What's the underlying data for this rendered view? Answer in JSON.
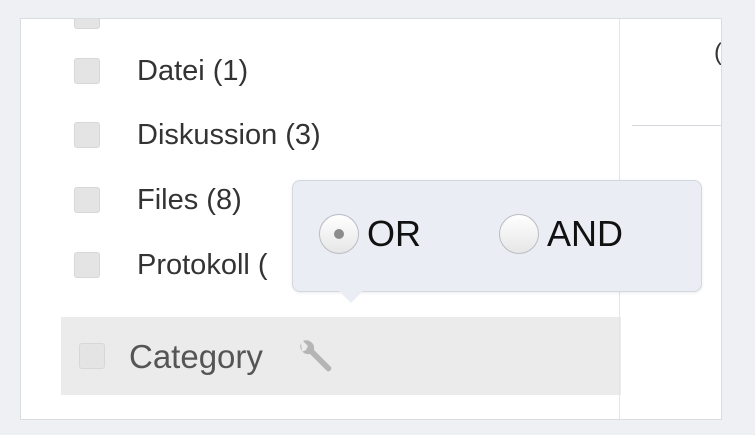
{
  "facets": [
    {
      "label": "Datei (1)",
      "checked": false
    },
    {
      "label": "Diskussion (3)",
      "checked": false
    },
    {
      "label": "Files (8)",
      "checked": false
    },
    {
      "label": "Protokoll (",
      "checked": false
    }
  ],
  "category": {
    "label": "Category",
    "icon": "wrench-icon"
  },
  "popover": {
    "options": [
      {
        "label": "OR",
        "selected": true
      },
      {
        "label": "AND",
        "selected": false
      }
    ]
  },
  "right_panel": {
    "peek_text": "("
  }
}
